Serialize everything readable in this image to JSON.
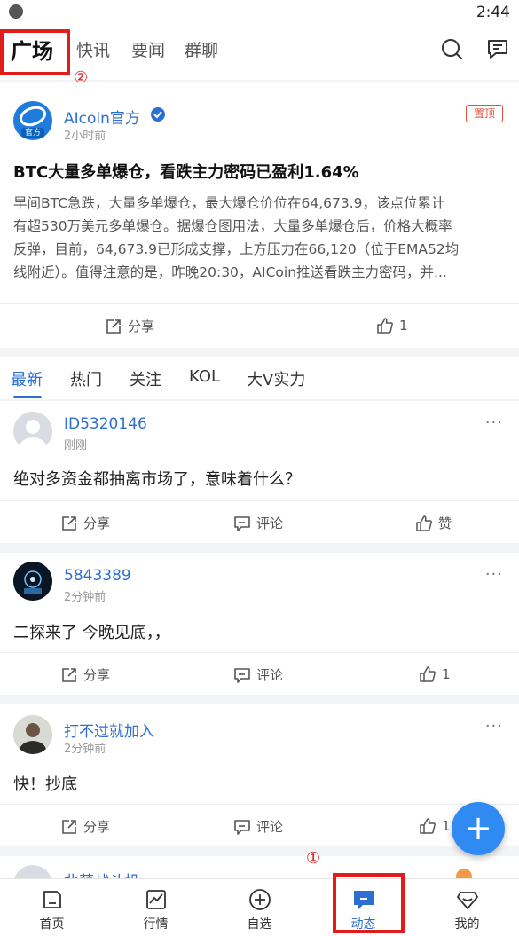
{
  "status_bar": {
    "time": "2:44"
  },
  "top_tabs": [
    "广场",
    "快讯",
    "要闻",
    "群聊"
  ],
  "annotations": {
    "circle_1": "①",
    "circle_2": "②"
  },
  "pinned": {
    "author": "AIcoin官方",
    "avatar_badge": "官方",
    "time": "2小时前",
    "pin_badge": "置顶",
    "title": "BTC大量多单爆仓，看跌主力密码已盈利1.64%",
    "body_lines": [
      "早间BTC急跌，大量多单爆仓，最大爆仓价位在64,673.9，该点位累计",
      "有超530万美元多单爆仓。据爆仓图用法，大量多单爆仓后，价格大概率",
      "反弹，目前，64,673.9已形成支撑，上方压力在66,120（位于EMA52均",
      "线附近）。值得注意的是，昨晚20:30，AICoin推送看跌主力密码，并..."
    ],
    "share_label": "分享",
    "like_count": "1"
  },
  "feed_tabs": [
    "最新",
    "热门",
    "关注",
    "KOL",
    "大V实力"
  ],
  "posts": [
    {
      "author": "ID5320146",
      "time": "刚刚",
      "text": "绝对多资金都抽离市场了，意味着什么？",
      "share": "分享",
      "comment": "评论",
      "like": "赞"
    },
    {
      "author": "5843389",
      "time": "2分钟前",
      "text": "二探来了  今晚见底，，",
      "share": "分享",
      "comment": "评论",
      "like": "1"
    },
    {
      "author": "打不过就加入",
      "time": "2分钟前",
      "text": "快！抄底",
      "share": "分享",
      "comment": "评论",
      "like": "1"
    }
  ],
  "partial_post_author": "北萌战斗机",
  "more_glyph": "···",
  "fab_glyph": "+",
  "bottom_nav": [
    "首页",
    "行情",
    "自选",
    "动态",
    "我的"
  ],
  "colors": {
    "accent": "#2d6fd0",
    "highlight": "#e21b1b",
    "fab": "#2f8bf2"
  }
}
